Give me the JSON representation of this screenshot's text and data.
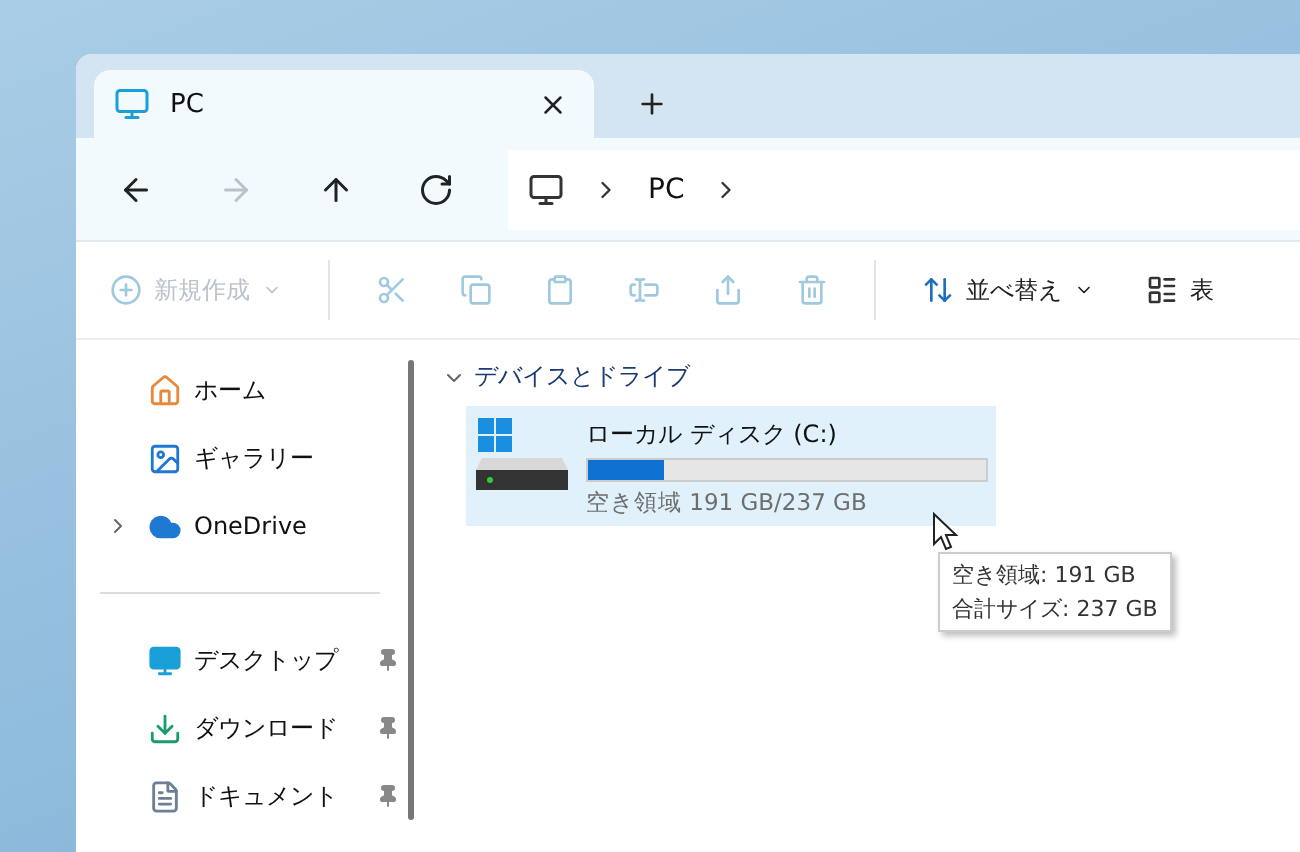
{
  "tab": {
    "title": "PC"
  },
  "nav": [
    {
      "kind": "back",
      "disabled": false
    },
    {
      "kind": "forward",
      "disabled": true
    },
    {
      "kind": "up",
      "disabled": false
    },
    {
      "kind": "refresh",
      "disabled": false
    }
  ],
  "address": {
    "crumbs": [
      "PC"
    ]
  },
  "toolbar": [
    {
      "kind": "new",
      "label": "新規作成",
      "disabled": true
    },
    {
      "kind": "cut",
      "disabled": true
    },
    {
      "kind": "copy",
      "disabled": true
    },
    {
      "kind": "paste",
      "disabled": true
    },
    {
      "kind": "rename",
      "disabled": true
    },
    {
      "kind": "share",
      "disabled": true
    },
    {
      "kind": "delete",
      "disabled": true
    },
    {
      "kind": "sort",
      "label": "並べ替え",
      "disabled": false
    },
    {
      "kind": "view",
      "label": "表",
      "disabled": false
    }
  ],
  "sidebar": {
    "sections": [
      [
        {
          "kind": "home",
          "label": "ホーム",
          "pinned": false
        },
        {
          "kind": "gallery",
          "label": "ギャラリー",
          "pinned": false
        },
        {
          "kind": "cloud",
          "label": "OneDrive",
          "pinned": false,
          "expanded": false
        }
      ],
      [
        {
          "kind": "desktop",
          "label": "デスクトップ",
          "pinned": true
        },
        {
          "kind": "download",
          "label": "ダウンロード",
          "pinned": true
        },
        {
          "kind": "document",
          "label": "ドキュメント",
          "pinned": true
        }
      ]
    ]
  },
  "group": {
    "title": "デバイスとドライブ",
    "expanded": true,
    "drives": [
      {
        "name": "ローカル ディスク (C:)",
        "level": 0.19,
        "free": "空き領域 191 GB/237 GB",
        "selected": true
      }
    ]
  },
  "tooltip": {
    "lines": [
      "空き領域: 191 GB",
      "合計サイズ: 237 GB"
    ]
  }
}
